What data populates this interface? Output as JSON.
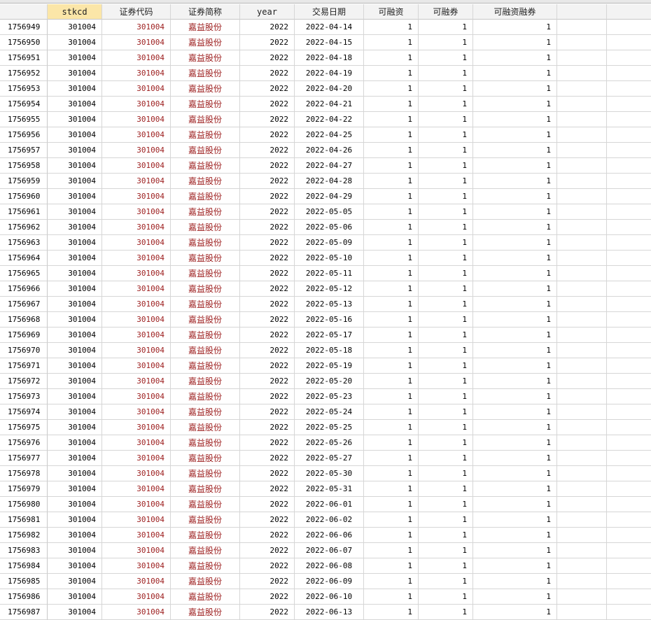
{
  "columns": [
    {
      "label": "stkcd"
    },
    {
      "label": "证券代码"
    },
    {
      "label": "证券简称"
    },
    {
      "label": "year"
    },
    {
      "label": "交易日期"
    },
    {
      "label": "可融资"
    },
    {
      "label": "可融券"
    },
    {
      "label": "可融资融券"
    }
  ],
  "colors": {
    "string_text": "#9c1d1d",
    "selected_header": "#fbe6a8",
    "grid_line": "#d6d6d6"
  },
  "rows": [
    {
      "obs": "1756949",
      "stkcd": "301004",
      "code": "301004",
      "name": "嘉益股份",
      "year": "2022",
      "date": "2022-04-14",
      "rz": "1",
      "rq": "1",
      "rzrq": "1"
    },
    {
      "obs": "1756950",
      "stkcd": "301004",
      "code": "301004",
      "name": "嘉益股份",
      "year": "2022",
      "date": "2022-04-15",
      "rz": "1",
      "rq": "1",
      "rzrq": "1"
    },
    {
      "obs": "1756951",
      "stkcd": "301004",
      "code": "301004",
      "name": "嘉益股份",
      "year": "2022",
      "date": "2022-04-18",
      "rz": "1",
      "rq": "1",
      "rzrq": "1"
    },
    {
      "obs": "1756952",
      "stkcd": "301004",
      "code": "301004",
      "name": "嘉益股份",
      "year": "2022",
      "date": "2022-04-19",
      "rz": "1",
      "rq": "1",
      "rzrq": "1"
    },
    {
      "obs": "1756953",
      "stkcd": "301004",
      "code": "301004",
      "name": "嘉益股份",
      "year": "2022",
      "date": "2022-04-20",
      "rz": "1",
      "rq": "1",
      "rzrq": "1"
    },
    {
      "obs": "1756954",
      "stkcd": "301004",
      "code": "301004",
      "name": "嘉益股份",
      "year": "2022",
      "date": "2022-04-21",
      "rz": "1",
      "rq": "1",
      "rzrq": "1"
    },
    {
      "obs": "1756955",
      "stkcd": "301004",
      "code": "301004",
      "name": "嘉益股份",
      "year": "2022",
      "date": "2022-04-22",
      "rz": "1",
      "rq": "1",
      "rzrq": "1"
    },
    {
      "obs": "1756956",
      "stkcd": "301004",
      "code": "301004",
      "name": "嘉益股份",
      "year": "2022",
      "date": "2022-04-25",
      "rz": "1",
      "rq": "1",
      "rzrq": "1"
    },
    {
      "obs": "1756957",
      "stkcd": "301004",
      "code": "301004",
      "name": "嘉益股份",
      "year": "2022",
      "date": "2022-04-26",
      "rz": "1",
      "rq": "1",
      "rzrq": "1"
    },
    {
      "obs": "1756958",
      "stkcd": "301004",
      "code": "301004",
      "name": "嘉益股份",
      "year": "2022",
      "date": "2022-04-27",
      "rz": "1",
      "rq": "1",
      "rzrq": "1"
    },
    {
      "obs": "1756959",
      "stkcd": "301004",
      "code": "301004",
      "name": "嘉益股份",
      "year": "2022",
      "date": "2022-04-28",
      "rz": "1",
      "rq": "1",
      "rzrq": "1"
    },
    {
      "obs": "1756960",
      "stkcd": "301004",
      "code": "301004",
      "name": "嘉益股份",
      "year": "2022",
      "date": "2022-04-29",
      "rz": "1",
      "rq": "1",
      "rzrq": "1"
    },
    {
      "obs": "1756961",
      "stkcd": "301004",
      "code": "301004",
      "name": "嘉益股份",
      "year": "2022",
      "date": "2022-05-05",
      "rz": "1",
      "rq": "1",
      "rzrq": "1"
    },
    {
      "obs": "1756962",
      "stkcd": "301004",
      "code": "301004",
      "name": "嘉益股份",
      "year": "2022",
      "date": "2022-05-06",
      "rz": "1",
      "rq": "1",
      "rzrq": "1"
    },
    {
      "obs": "1756963",
      "stkcd": "301004",
      "code": "301004",
      "name": "嘉益股份",
      "year": "2022",
      "date": "2022-05-09",
      "rz": "1",
      "rq": "1",
      "rzrq": "1"
    },
    {
      "obs": "1756964",
      "stkcd": "301004",
      "code": "301004",
      "name": "嘉益股份",
      "year": "2022",
      "date": "2022-05-10",
      "rz": "1",
      "rq": "1",
      "rzrq": "1"
    },
    {
      "obs": "1756965",
      "stkcd": "301004",
      "code": "301004",
      "name": "嘉益股份",
      "year": "2022",
      "date": "2022-05-11",
      "rz": "1",
      "rq": "1",
      "rzrq": "1"
    },
    {
      "obs": "1756966",
      "stkcd": "301004",
      "code": "301004",
      "name": "嘉益股份",
      "year": "2022",
      "date": "2022-05-12",
      "rz": "1",
      "rq": "1",
      "rzrq": "1"
    },
    {
      "obs": "1756967",
      "stkcd": "301004",
      "code": "301004",
      "name": "嘉益股份",
      "year": "2022",
      "date": "2022-05-13",
      "rz": "1",
      "rq": "1",
      "rzrq": "1"
    },
    {
      "obs": "1756968",
      "stkcd": "301004",
      "code": "301004",
      "name": "嘉益股份",
      "year": "2022",
      "date": "2022-05-16",
      "rz": "1",
      "rq": "1",
      "rzrq": "1"
    },
    {
      "obs": "1756969",
      "stkcd": "301004",
      "code": "301004",
      "name": "嘉益股份",
      "year": "2022",
      "date": "2022-05-17",
      "rz": "1",
      "rq": "1",
      "rzrq": "1"
    },
    {
      "obs": "1756970",
      "stkcd": "301004",
      "code": "301004",
      "name": "嘉益股份",
      "year": "2022",
      "date": "2022-05-18",
      "rz": "1",
      "rq": "1",
      "rzrq": "1"
    },
    {
      "obs": "1756971",
      "stkcd": "301004",
      "code": "301004",
      "name": "嘉益股份",
      "year": "2022",
      "date": "2022-05-19",
      "rz": "1",
      "rq": "1",
      "rzrq": "1"
    },
    {
      "obs": "1756972",
      "stkcd": "301004",
      "code": "301004",
      "name": "嘉益股份",
      "year": "2022",
      "date": "2022-05-20",
      "rz": "1",
      "rq": "1",
      "rzrq": "1"
    },
    {
      "obs": "1756973",
      "stkcd": "301004",
      "code": "301004",
      "name": "嘉益股份",
      "year": "2022",
      "date": "2022-05-23",
      "rz": "1",
      "rq": "1",
      "rzrq": "1"
    },
    {
      "obs": "1756974",
      "stkcd": "301004",
      "code": "301004",
      "name": "嘉益股份",
      "year": "2022",
      "date": "2022-05-24",
      "rz": "1",
      "rq": "1",
      "rzrq": "1"
    },
    {
      "obs": "1756975",
      "stkcd": "301004",
      "code": "301004",
      "name": "嘉益股份",
      "year": "2022",
      "date": "2022-05-25",
      "rz": "1",
      "rq": "1",
      "rzrq": "1"
    },
    {
      "obs": "1756976",
      "stkcd": "301004",
      "code": "301004",
      "name": "嘉益股份",
      "year": "2022",
      "date": "2022-05-26",
      "rz": "1",
      "rq": "1",
      "rzrq": "1"
    },
    {
      "obs": "1756977",
      "stkcd": "301004",
      "code": "301004",
      "name": "嘉益股份",
      "year": "2022",
      "date": "2022-05-27",
      "rz": "1",
      "rq": "1",
      "rzrq": "1"
    },
    {
      "obs": "1756978",
      "stkcd": "301004",
      "code": "301004",
      "name": "嘉益股份",
      "year": "2022",
      "date": "2022-05-30",
      "rz": "1",
      "rq": "1",
      "rzrq": "1"
    },
    {
      "obs": "1756979",
      "stkcd": "301004",
      "code": "301004",
      "name": "嘉益股份",
      "year": "2022",
      "date": "2022-05-31",
      "rz": "1",
      "rq": "1",
      "rzrq": "1"
    },
    {
      "obs": "1756980",
      "stkcd": "301004",
      "code": "301004",
      "name": "嘉益股份",
      "year": "2022",
      "date": "2022-06-01",
      "rz": "1",
      "rq": "1",
      "rzrq": "1"
    },
    {
      "obs": "1756981",
      "stkcd": "301004",
      "code": "301004",
      "name": "嘉益股份",
      "year": "2022",
      "date": "2022-06-02",
      "rz": "1",
      "rq": "1",
      "rzrq": "1"
    },
    {
      "obs": "1756982",
      "stkcd": "301004",
      "code": "301004",
      "name": "嘉益股份",
      "year": "2022",
      "date": "2022-06-06",
      "rz": "1",
      "rq": "1",
      "rzrq": "1"
    },
    {
      "obs": "1756983",
      "stkcd": "301004",
      "code": "301004",
      "name": "嘉益股份",
      "year": "2022",
      "date": "2022-06-07",
      "rz": "1",
      "rq": "1",
      "rzrq": "1"
    },
    {
      "obs": "1756984",
      "stkcd": "301004",
      "code": "301004",
      "name": "嘉益股份",
      "year": "2022",
      "date": "2022-06-08",
      "rz": "1",
      "rq": "1",
      "rzrq": "1"
    },
    {
      "obs": "1756985",
      "stkcd": "301004",
      "code": "301004",
      "name": "嘉益股份",
      "year": "2022",
      "date": "2022-06-09",
      "rz": "1",
      "rq": "1",
      "rzrq": "1"
    },
    {
      "obs": "1756986",
      "stkcd": "301004",
      "code": "301004",
      "name": "嘉益股份",
      "year": "2022",
      "date": "2022-06-10",
      "rz": "1",
      "rq": "1",
      "rzrq": "1"
    },
    {
      "obs": "1756987",
      "stkcd": "301004",
      "code": "301004",
      "name": "嘉益股份",
      "year": "2022",
      "date": "2022-06-13",
      "rz": "1",
      "rq": "1",
      "rzrq": "1"
    }
  ]
}
